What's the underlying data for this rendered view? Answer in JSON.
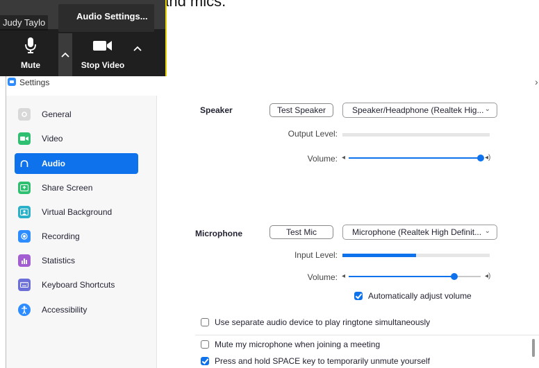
{
  "caption": "selections for speakers and mics.",
  "zoom_toolbar": {
    "participant_name": "Judy Taylo",
    "audio_settings_tip": "Audio Settings...",
    "mute_label": "Mute",
    "stop_video_label": "Stop Video"
  },
  "window": {
    "title": "Settings",
    "close": "›"
  },
  "sidebar": {
    "items": [
      {
        "label": "General",
        "icon": "gear-icon",
        "color": "#d8d8d8"
      },
      {
        "label": "Video",
        "icon": "video-icon",
        "color": "#2fbf71"
      },
      {
        "label": "Audio",
        "icon": "headphones-icon",
        "color": "#0e72ed"
      },
      {
        "label": "Share Screen",
        "icon": "share-screen-icon",
        "color": "#2fbf71"
      },
      {
        "label": "Virtual Background",
        "icon": "virtual-background-icon",
        "color": "#2ab0c9"
      },
      {
        "label": "Recording",
        "icon": "recording-icon",
        "color": "#2d8cff"
      },
      {
        "label": "Statistics",
        "icon": "statistics-icon",
        "color": "#a35fd1"
      },
      {
        "label": "Keyboard Shortcuts",
        "icon": "keyboard-icon",
        "color": "#6d6fd9"
      },
      {
        "label": "Accessibility",
        "icon": "accessibility-icon",
        "color": "#2d8cff"
      }
    ],
    "active_index": 2
  },
  "audio": {
    "speaker": {
      "label": "Speaker",
      "test_button": "Test Speaker",
      "device": "Speaker/Headphone (Realtek Hig...",
      "output_level_label": "Output Level:",
      "output_level": 0,
      "volume_label": "Volume:",
      "volume": 1.0
    },
    "microphone": {
      "label": "Microphone",
      "test_button": "Test Mic",
      "device": "Microphone (Realtek High Definit...",
      "input_level_label": "Input Level:",
      "input_level": 0.5,
      "volume_label": "Volume:",
      "volume": 0.8,
      "auto_adjust_label": "Automatically adjust volume",
      "auto_adjust": true
    },
    "options": [
      {
        "label": "Use separate audio device to play ringtone simultaneously",
        "checked": false
      },
      {
        "label": "Mute my microphone when joining a meeting",
        "checked": false
      },
      {
        "label": "Press and hold SPACE key to temporarily unmute yourself",
        "checked": true
      }
    ]
  },
  "colors": {
    "accent": "#0e72ed"
  }
}
